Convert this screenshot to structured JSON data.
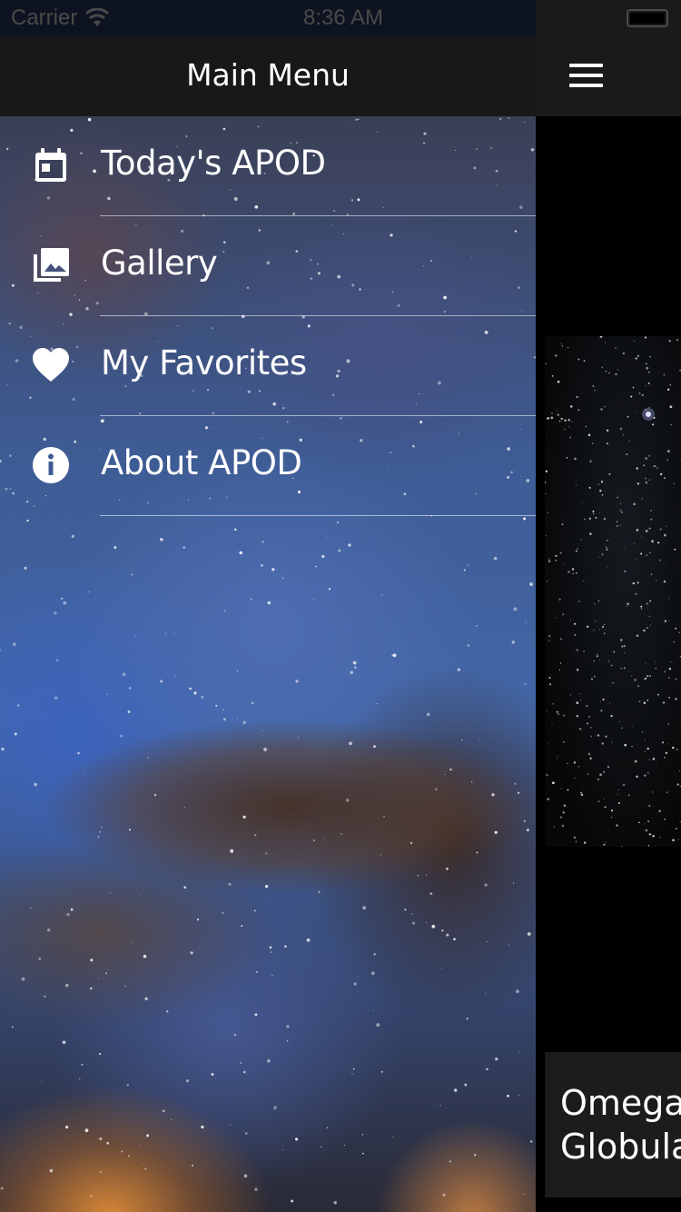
{
  "status_bar": {
    "carrier": "Carrier",
    "time": "8:36 AM"
  },
  "drawer": {
    "title": "Main Menu",
    "items": [
      {
        "label": "Today's APOD",
        "icon": "calendar-icon"
      },
      {
        "label": "Gallery",
        "icon": "photo-library-icon"
      },
      {
        "label": "My Favorites",
        "icon": "heart-icon"
      },
      {
        "label": "About APOD",
        "icon": "info-icon"
      }
    ]
  },
  "content": {
    "menu_icon": "hamburger-menu-icon",
    "caption": "Omega\nGlobula"
  },
  "colors": {
    "header_bg": "#181818",
    "text": "#ffffff",
    "status_text": "#4a4a4a"
  }
}
